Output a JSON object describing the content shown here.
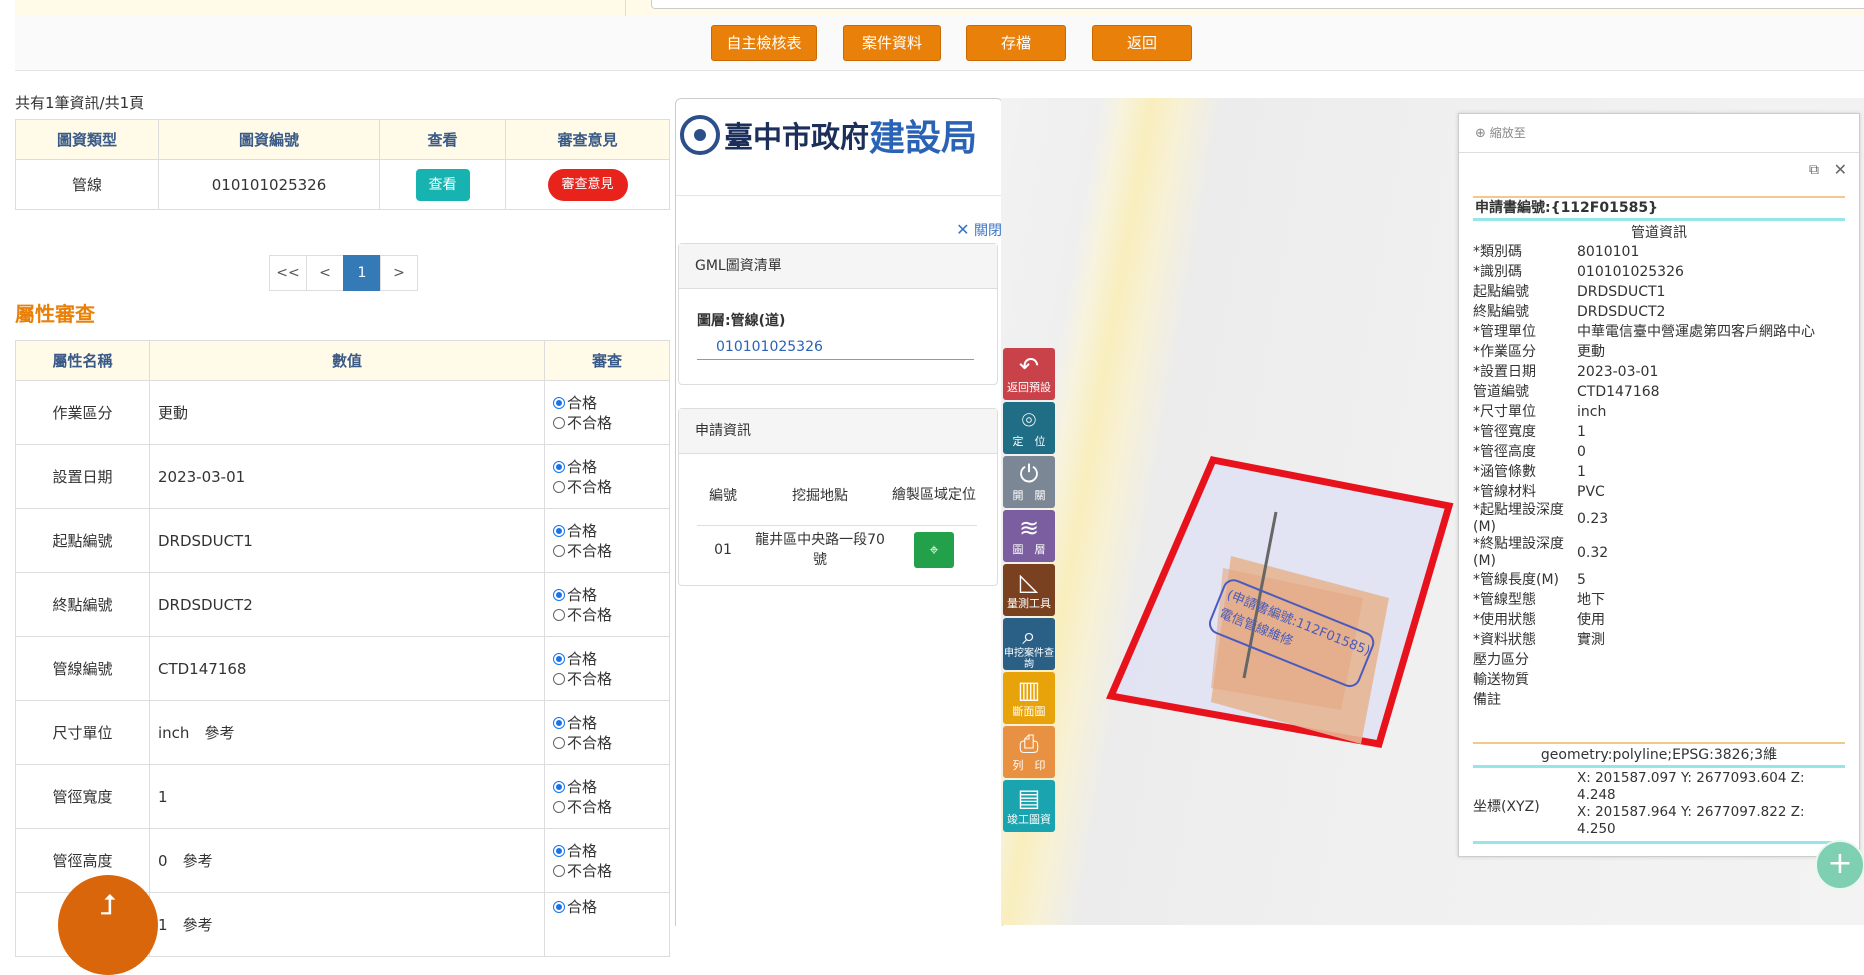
{
  "toolbar": {
    "buttons": [
      {
        "label": "自主檢核表"
      },
      {
        "label": "案件資料"
      },
      {
        "label": "存檔"
      },
      {
        "label": "返回"
      }
    ]
  },
  "result_count": "共有1筆資訊/共1頁",
  "files_table": {
    "headers": [
      "圖資類型",
      "圖資編號",
      "查看",
      "審查意見"
    ],
    "rows": [
      {
        "type": "管線",
        "id": "010101025326",
        "view_label": "查看",
        "review_label": "審查意見"
      }
    ]
  },
  "pager": {
    "first": "<<",
    "prev": "<",
    "current": "1",
    "next": ">"
  },
  "attr_section_title": "屬性審查",
  "attr_table": {
    "headers": [
      "屬性名稱",
      "數值",
      "審查"
    ],
    "pass_label": "合格",
    "fail_label": "不合格",
    "rows": [
      {
        "name": "作業區分",
        "value": "更動",
        "ref": ""
      },
      {
        "name": "設置日期",
        "value": "2023-03-01",
        "ref": ""
      },
      {
        "name": "起點編號",
        "value": "DRDSDUCT1",
        "ref": ""
      },
      {
        "name": "終點編號",
        "value": "DRDSDUCT2",
        "ref": ""
      },
      {
        "name": "管線編號",
        "value": "CTD147168",
        "ref": ""
      },
      {
        "name": "尺寸單位",
        "value": "inch",
        "ref": "參考"
      },
      {
        "name": "管徑寬度",
        "value": "1",
        "ref": ""
      },
      {
        "name": "管徑高度",
        "value": "0",
        "ref": "參考"
      },
      {
        "name": "",
        "value": "1",
        "ref": "參考"
      }
    ]
  },
  "mid": {
    "logo_text1": "臺中市政府",
    "logo_text2": "建設局",
    "close_label": "關閉",
    "gml_header": "GML圖資清單",
    "layer_label": "圖層:管線(道)",
    "layer_item": "010101025326",
    "apply_header": "申請資訊",
    "apply_table": {
      "headers": [
        "編號",
        "挖掘地點",
        "繪製區域定位"
      ],
      "rows": [
        {
          "no": "01",
          "location": "龍井區中央路一段70號"
        }
      ]
    }
  },
  "map_tools": [
    {
      "label": "返回預設",
      "icon": "return-icon",
      "color": "#c9424a"
    },
    {
      "label": "定　位",
      "icon": "locate-icon",
      "color": "#1f6e86"
    },
    {
      "label": "開　關",
      "icon": "power-icon",
      "color": "#7b8794"
    },
    {
      "label": "圖　層",
      "icon": "layers-icon",
      "color": "#7b5ea0"
    },
    {
      "label": "量測工具",
      "icon": "ruler-icon",
      "color": "#7a4120"
    },
    {
      "label": "申挖案件查詢",
      "icon": "magnifier-icon",
      "color": "#2a5f86"
    },
    {
      "label": "斷面圖",
      "icon": "section-icon",
      "color": "#e8a20a"
    },
    {
      "label": "列　印",
      "icon": "printer-icon",
      "color": "#e89142"
    },
    {
      "label": "竣工圖資",
      "icon": "document-icon",
      "color": "#1aa4b0"
    }
  ],
  "map": {
    "stamp_line1": "(申請書編號:112F01585)",
    "stamp_line2": "電信管線維修"
  },
  "info": {
    "search_placeholder": "縮放至",
    "title": "申請書編號:{112F01585}",
    "subtitle": "管道資訊",
    "rows": [
      {
        "k": "*類別碼",
        "v": "8010101"
      },
      {
        "k": "*識別碼",
        "v": "010101025326"
      },
      {
        "k": "起點編號",
        "v": "DRDSDUCT1"
      },
      {
        "k": "終點編號",
        "v": "DRDSDUCT2"
      },
      {
        "k": "*管理單位",
        "v": "中華電信臺中營運處第四客戶網路中心"
      },
      {
        "k": "*作業區分",
        "v": "更動"
      },
      {
        "k": "*設置日期",
        "v": "2023-03-01"
      },
      {
        "k": "管道編號",
        "v": "CTD147168"
      },
      {
        "k": "*尺寸單位",
        "v": "inch"
      },
      {
        "k": "*管徑寬度",
        "v": "1"
      },
      {
        "k": "*管徑高度",
        "v": "0"
      },
      {
        "k": "*涵管條數",
        "v": "1"
      },
      {
        "k": "*管線材料",
        "v": "PVC"
      },
      {
        "k": "*起點埋設深度(M)",
        "v": "0.23"
      },
      {
        "k": "*終點埋設深度(M)",
        "v": "0.32"
      },
      {
        "k": "*管線長度(M)",
        "v": "5"
      },
      {
        "k": "*管線型態",
        "v": "地下"
      },
      {
        "k": "*使用狀態",
        "v": "使用"
      },
      {
        "k": "*資料狀態",
        "v": "實測"
      },
      {
        "k": "壓力區分",
        "v": ""
      },
      {
        "k": "輸送物質",
        "v": ""
      },
      {
        "k": "備註",
        "v": ""
      }
    ],
    "geometry": "geometry:polyline;EPSG:3826;3維",
    "coord_label": "坐標(XYZ)",
    "coord1": "X: 201587.097 Y: 2677093.604 Z: 4.248",
    "coord2": "X: 201587.964 Y: 2677097.822 Z: 4.250"
  }
}
